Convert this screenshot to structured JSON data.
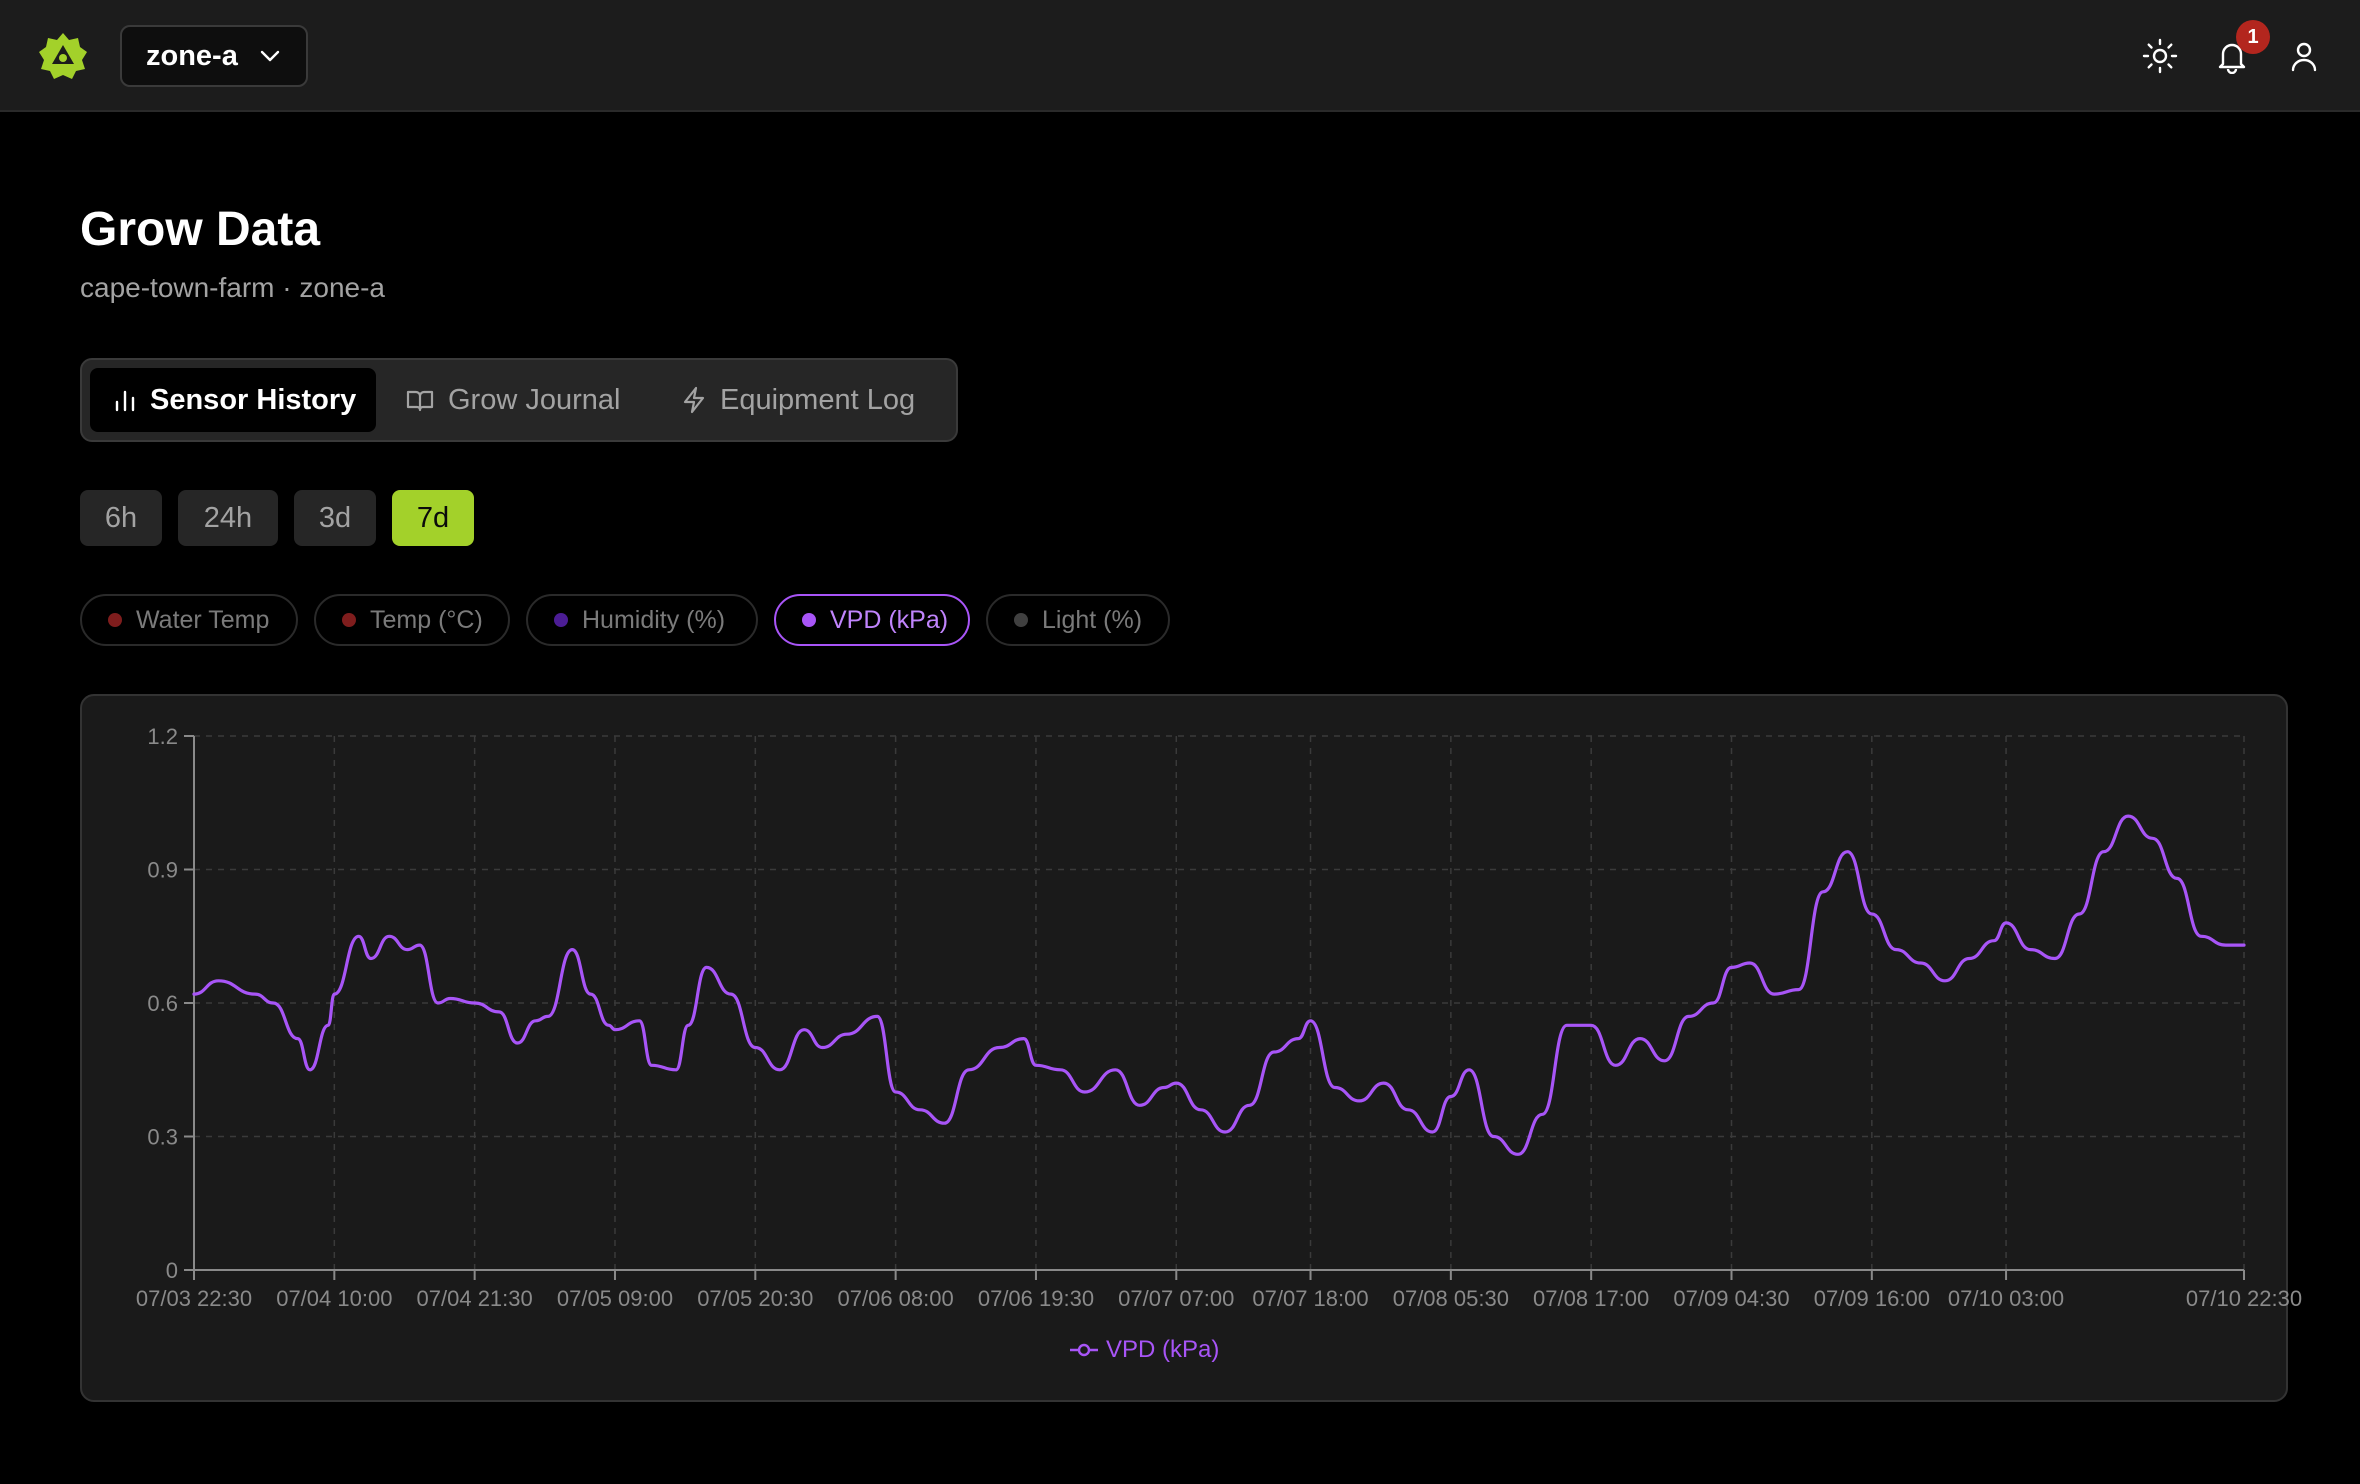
{
  "header": {
    "zone_selector": "zone-a",
    "notifications_count": "1"
  },
  "page": {
    "title": "Grow Data",
    "subtitle": "cape-town-farm · zone-a"
  },
  "tabs": [
    {
      "label": "Sensor History",
      "icon": "bar-chart-icon",
      "active": true
    },
    {
      "label": "Grow Journal",
      "icon": "book-icon",
      "active": false
    },
    {
      "label": "Equipment Log",
      "icon": "lightning-icon",
      "active": false
    }
  ],
  "time_ranges": [
    {
      "label": "6h",
      "active": false
    },
    {
      "label": "24h",
      "active": false
    },
    {
      "label": "3d",
      "active": false
    },
    {
      "label": "7d",
      "active": true
    }
  ],
  "metrics": [
    {
      "label": "Water Temp",
      "color": "#7f1d1d",
      "active": false
    },
    {
      "label": "Temp (°C)",
      "color": "#7f1d1d",
      "active": false
    },
    {
      "label": "Humidity (%)",
      "color": "#4c1d95",
      "active": false
    },
    {
      "label": "VPD (kPa)",
      "color": "#a855f7",
      "active": true
    },
    {
      "label": "Light (%)",
      "color": "#404040",
      "active": false
    }
  ],
  "colors": {
    "accent": "#a3d12a",
    "series": "#a855f7"
  },
  "chart_data": {
    "type": "line",
    "title": "",
    "xlabel": "",
    "ylabel": "",
    "ylim": [
      0,
      1.2
    ],
    "yticks": [
      0,
      0.3,
      0.6,
      0.9,
      1.2
    ],
    "xticks": [
      "07/03 22:30",
      "07/04 10:00",
      "07/04 21:30",
      "07/05 09:00",
      "07/05 20:30",
      "07/06 08:00",
      "07/06 19:30",
      "07/07 07:00",
      "07/07 18:00",
      "07/08 05:30",
      "07/08 17:00",
      "07/09 04:30",
      "07/09 16:00",
      "07/10 03:00",
      "07/10 22:30"
    ],
    "x_range": [
      "07/03 22:30",
      "07/10 22:30"
    ],
    "grid": true,
    "legend": "bottom",
    "series": [
      {
        "name": "VPD (kPa)",
        "x": [
          "07/03 22:30",
          "07/04 00:30",
          "07/04 03:30",
          "07/04 05:00",
          "07/04 07:00",
          "07/04 08:00",
          "07/04 09:30",
          "07/04 10:00",
          "07/04 12:00",
          "07/04 13:00",
          "07/04 14:30",
          "07/04 16:00",
          "07/04 17:00",
          "07/04 18:30",
          "07/04 19:30",
          "07/04 21:30",
          "07/04 23:30",
          "07/05 01:00",
          "07/05 02:30",
          "07/05 03:30",
          "07/05 05:30",
          "07/05 07:00",
          "07/05 08:30",
          "07/05 09:00",
          "07/05 11:00",
          "07/05 12:00",
          "07/05 14:00",
          "07/05 15:00",
          "07/05 16:30",
          "07/05 18:30",
          "07/05 20:30",
          "07/05 22:30",
          "07/06 00:30",
          "07/06 02:00",
          "07/06 04:00",
          "07/06 06:30",
          "07/06 08:00",
          "07/06 10:00",
          "07/06 12:00",
          "07/06 14:00",
          "07/06 16:30",
          "07/06 18:30",
          "07/06 19:30",
          "07/06 21:30",
          "07/06 23:30",
          "07/07 02:00",
          "07/07 04:00",
          "07/07 06:00",
          "07/07 07:00",
          "07/07 09:00",
          "07/07 11:00",
          "07/07 13:00",
          "07/07 15:00",
          "07/07 17:00",
          "07/07 18:00",
          "07/07 20:00",
          "07/07 22:00",
          "07/08 00:00",
          "07/08 02:00",
          "07/08 04:00",
          "07/08 05:30",
          "07/08 07:00",
          "07/08 09:00",
          "07/08 11:00",
          "07/08 13:00",
          "07/08 15:00",
          "07/08 17:00",
          "07/08 19:00",
          "07/08 21:00",
          "07/08 23:00",
          "07/09 01:00",
          "07/09 03:00",
          "07/09 04:30",
          "07/09 06:00",
          "07/09 08:00",
          "07/09 10:00",
          "07/09 12:00",
          "07/09 14:00",
          "07/09 16:00",
          "07/09 18:00",
          "07/09 20:00",
          "07/09 22:00",
          "07/10 00:00",
          "07/10 02:00",
          "07/10 03:00",
          "07/10 05:00",
          "07/10 07:00",
          "07/10 09:00",
          "07/10 11:00",
          "07/10 13:00",
          "07/10 15:00",
          "07/10 17:00",
          "07/10 19:00",
          "07/10 21:00",
          "07/10 22:30"
        ],
        "values": [
          0.62,
          0.65,
          0.62,
          0.6,
          0.52,
          0.45,
          0.55,
          0.62,
          0.75,
          0.7,
          0.75,
          0.72,
          0.73,
          0.6,
          0.61,
          0.6,
          0.58,
          0.51,
          0.56,
          0.57,
          0.72,
          0.62,
          0.55,
          0.54,
          0.56,
          0.46,
          0.45,
          0.55,
          0.68,
          0.62,
          0.5,
          0.45,
          0.54,
          0.5,
          0.53,
          0.57,
          0.4,
          0.36,
          0.33,
          0.45,
          0.5,
          0.52,
          0.46,
          0.45,
          0.4,
          0.45,
          0.37,
          0.41,
          0.42,
          0.36,
          0.31,
          0.37,
          0.49,
          0.52,
          0.56,
          0.41,
          0.38,
          0.42,
          0.36,
          0.31,
          0.39,
          0.45,
          0.3,
          0.26,
          0.35,
          0.55,
          0.55,
          0.46,
          0.52,
          0.47,
          0.57,
          0.6,
          0.68,
          0.69,
          0.62,
          0.63,
          0.85,
          0.94,
          0.8,
          0.72,
          0.69,
          0.65,
          0.7,
          0.74,
          0.78,
          0.72,
          0.7,
          0.8,
          0.94,
          1.02,
          0.97,
          0.88,
          0.75,
          0.73,
          0.73
        ]
      }
    ]
  }
}
